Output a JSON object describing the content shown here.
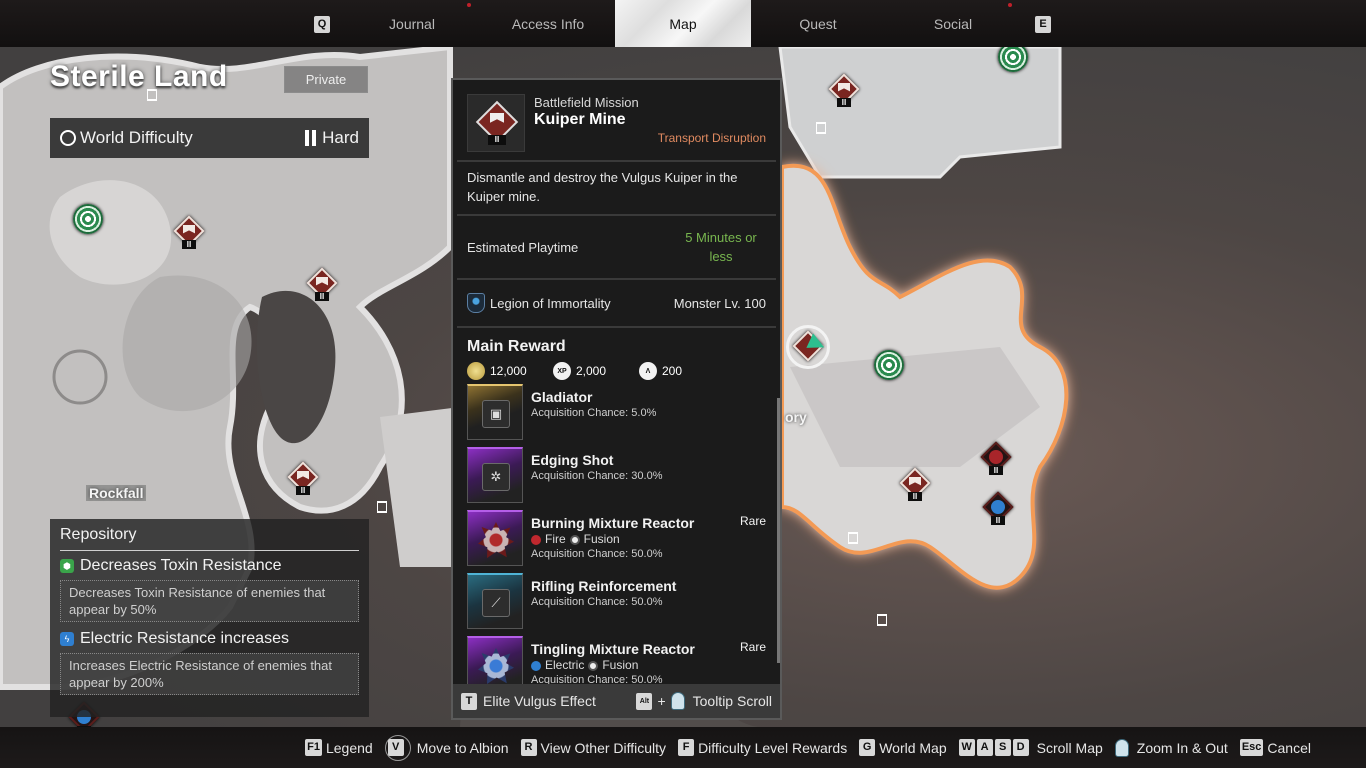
{
  "top_nav": {
    "prev_key": "Q",
    "next_key": "E",
    "tabs": [
      {
        "label": "Journal",
        "active": false,
        "notification": true
      },
      {
        "label": "Access Info",
        "active": false,
        "notification": false
      },
      {
        "label": "Map",
        "active": true,
        "notification": false
      },
      {
        "label": "Quest",
        "active": false,
        "notification": false
      },
      {
        "label": "Social",
        "active": false,
        "notification": true
      }
    ]
  },
  "region": {
    "title": "Sterile Land",
    "session_type": "Private",
    "difficulty_label": "World Difficulty",
    "difficulty_value": "Hard"
  },
  "map": {
    "labels": [
      "Rockfall",
      "ory"
    ],
    "marker_level": "II"
  },
  "mission": {
    "category": "Battlefield Mission",
    "title": "Kuiper Mine",
    "subtype": "Transport Disruption",
    "description": "Dismantle and destroy the Vulgus Kuiper in the Kuiper mine.",
    "playtime_label": "Estimated Playtime",
    "playtime_value": "5 Minutes or less",
    "faction": "Legion of Immortality",
    "monster_level": "Monster Lv. 100",
    "main_reward_title": "Main Reward",
    "currency": [
      {
        "icon": "gold-icon",
        "value": "12,000"
      },
      {
        "icon": "xp-icon",
        "value": "2,000"
      },
      {
        "icon": "mastery-icon",
        "value": "200"
      }
    ],
    "rewards": [
      {
        "name": "Gladiator",
        "chance": "Acquisition Chance: 5.0%",
        "rarity": "",
        "tags": [],
        "tier": "gold"
      },
      {
        "name": "Edging Shot",
        "chance": "Acquisition Chance: 30.0%",
        "rarity": "",
        "tags": [],
        "tier": "purple"
      },
      {
        "name": "Burning Mixture Reactor",
        "chance": "Acquisition Chance: 50.0%",
        "rarity": "Rare",
        "tags": [
          "Fire",
          "Fusion"
        ],
        "tier": "purple"
      },
      {
        "name": "Rifling Reinforcement",
        "chance": "Acquisition Chance: 50.0%",
        "rarity": "",
        "tags": [],
        "tier": "teal"
      },
      {
        "name": "Tingling Mixture Reactor",
        "chance": "Acquisition Chance: 50.0%",
        "rarity": "Rare",
        "tags": [
          "Electric",
          "Fusion"
        ],
        "tier": "purple"
      }
    ],
    "footer": {
      "elite_key": "T",
      "elite_label": "Elite Vulgus Effect",
      "scroll_key": "Alt",
      "scroll_plus": "+",
      "scroll_label": "Tooltip Scroll"
    }
  },
  "repository": {
    "title": "Repository",
    "effects": [
      {
        "title": "Decreases Toxin Resistance",
        "description": "Decreases Toxin Resistance of enemies that appear by 50%",
        "color": "#3aa44a"
      },
      {
        "title": "Electric Resistance increases",
        "description": "Increases Electric Resistance of enemies that appear by 200%",
        "color": "#2f7fd0"
      }
    ]
  },
  "bottom_hints": [
    {
      "key": "F1",
      "label": "Legend"
    },
    {
      "key": "V",
      "label": "Move to Albion"
    },
    {
      "key": "R",
      "label": "View Other Difficulty"
    },
    {
      "key": "F",
      "label": "Difficulty Level Rewards"
    },
    {
      "key": "G",
      "label": "World Map"
    },
    {
      "keys": [
        "W",
        "A",
        "S",
        "D"
      ],
      "label": "Scroll Map"
    },
    {
      "key": "mouse-wheel",
      "label": "Zoom In & Out"
    },
    {
      "key": "Esc",
      "label": "Cancel"
    }
  ],
  "colors": {
    "accent_orange": "#e08a60",
    "playtime_green": "#78b64f",
    "mission_red": "#7a2621"
  }
}
